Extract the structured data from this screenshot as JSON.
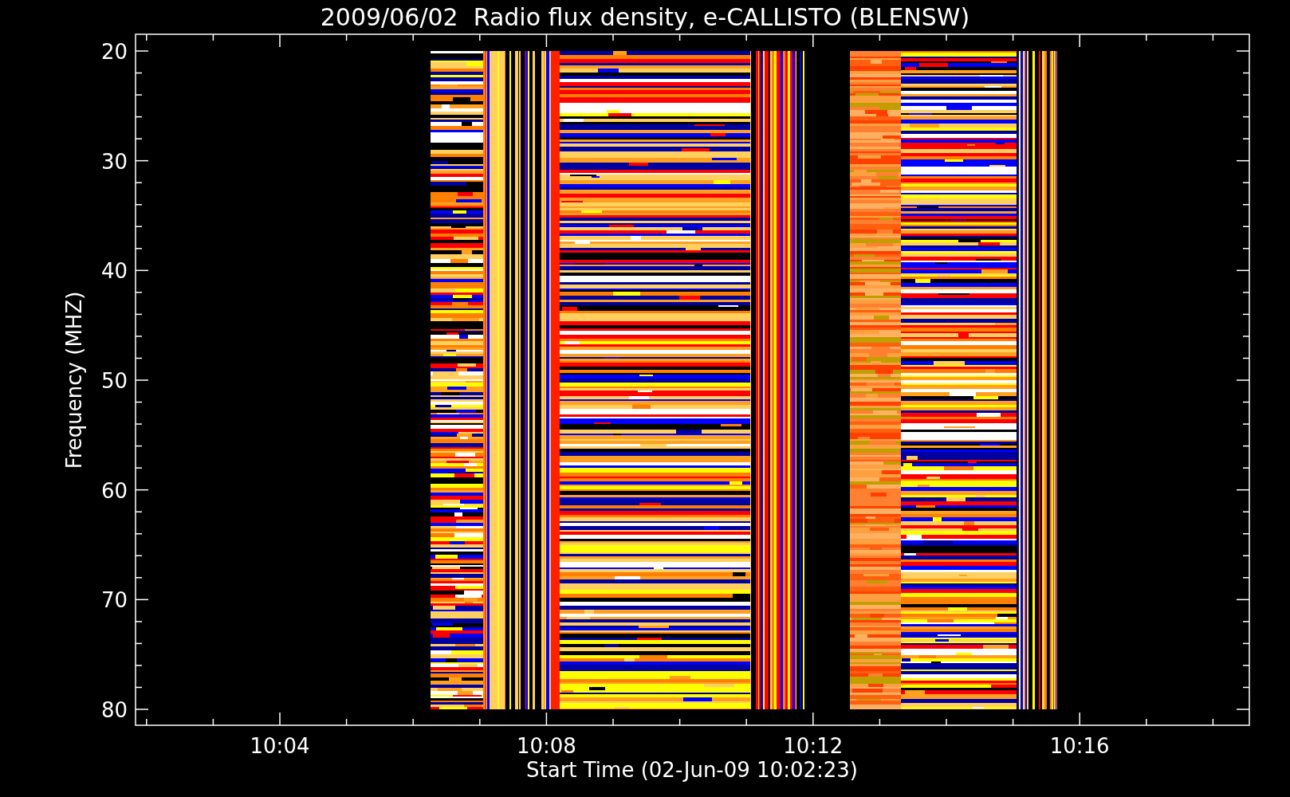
{
  "title": "2009/06/02  Radio flux density, e-CALLISTO (BLENSW)",
  "axes": {
    "ylabel": "Frequency (MHZ)",
    "xlabel": "Start Time (02-Jun-09 10:02:23)",
    "yticks": [
      "20",
      "30",
      "40",
      "50",
      "60",
      "70",
      "80"
    ],
    "xticks": [
      "10:04",
      "10:08",
      "10:12",
      "10:16"
    ]
  }
}
